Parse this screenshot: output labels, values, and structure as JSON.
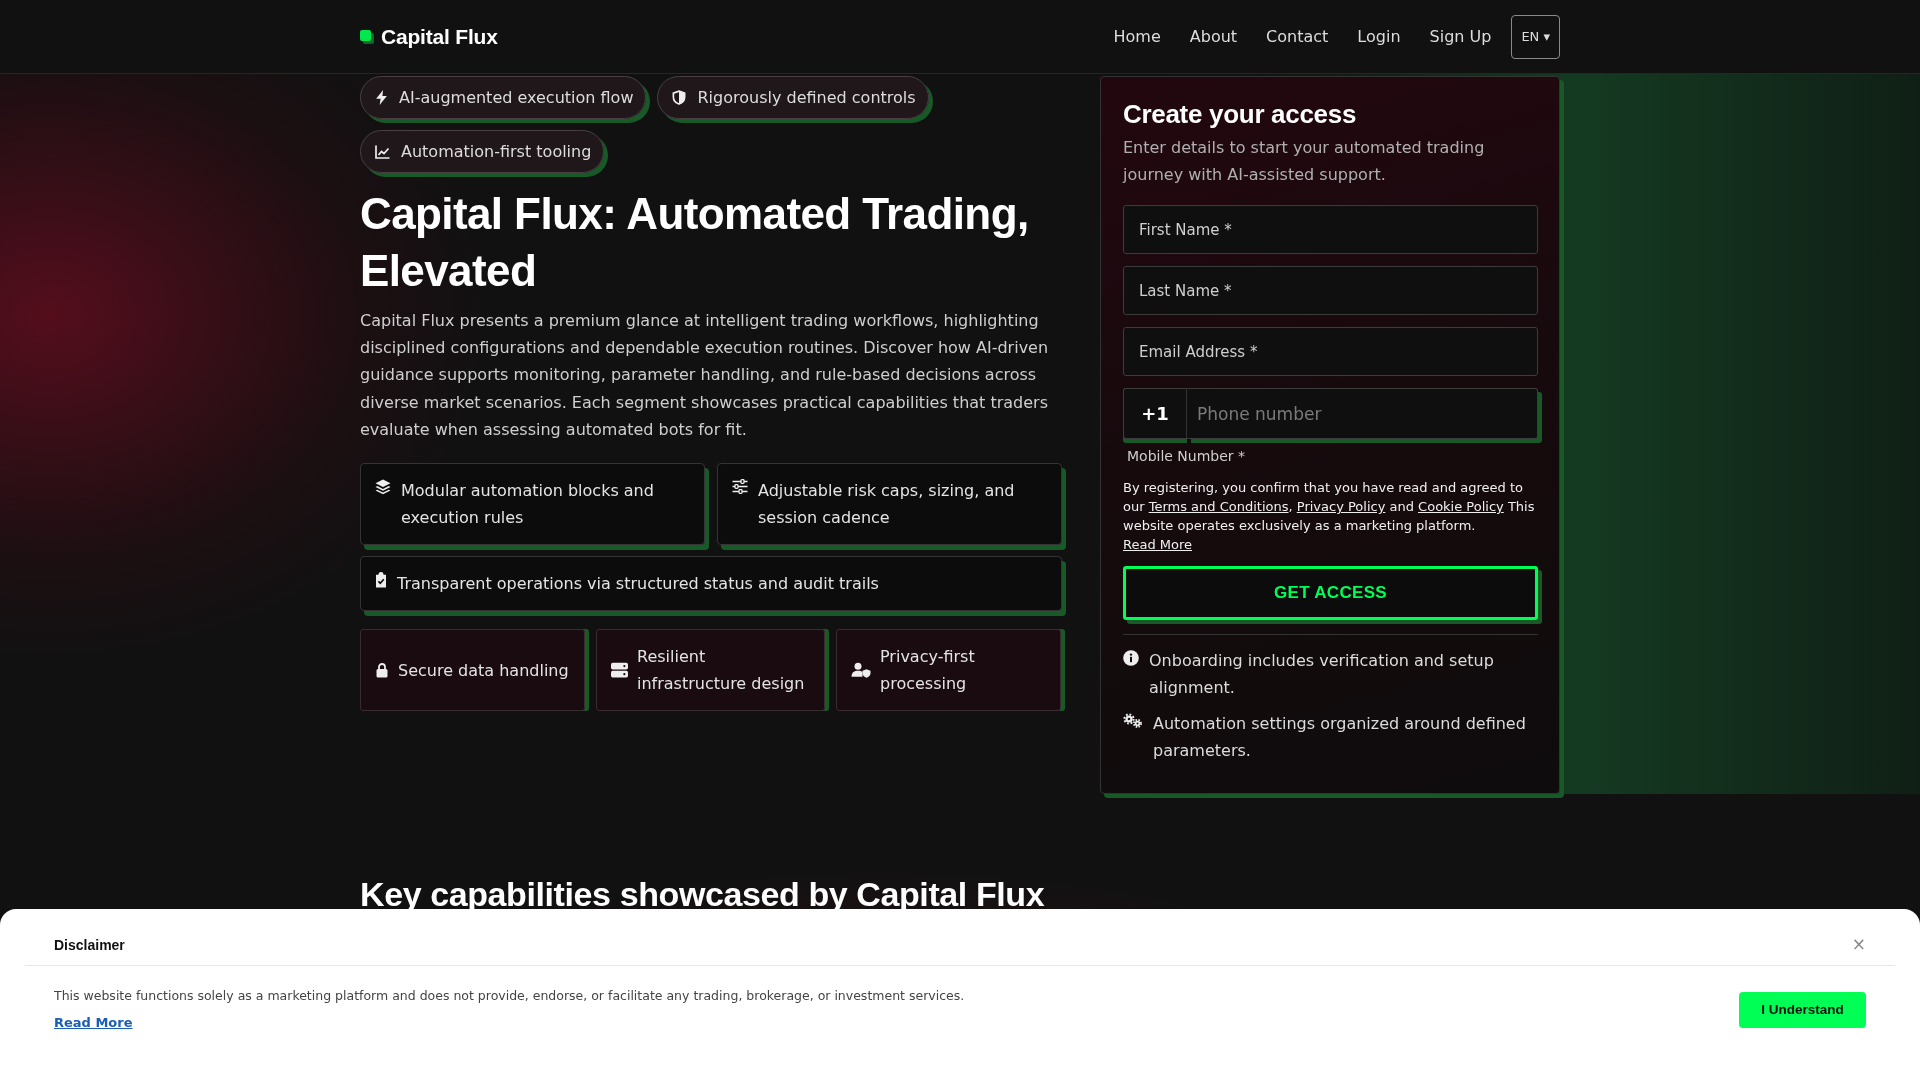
{
  "header": {
    "logo": "Capital Flux",
    "nav": [
      "Home",
      "About",
      "Contact",
      "Login",
      "Sign Up"
    ],
    "language": "EN ▾"
  },
  "hero": {
    "badges": [
      "AI-augmented execution flow",
      "Rigorously defined controls",
      "Automation-first tooling"
    ],
    "title": "Capital Flux: Automated Trading, Elevated",
    "intro": "Capital Flux presents a premium glance at intelligent trading workflows, highlighting disciplined configurations and dependable execution routines. Discover how AI-driven guidance supports monitoring, parameter handling, and rule-based decisions across diverse market scenarios. Each segment showcases practical capabilities that traders evaluate when assessing automated bots for fit.",
    "feature_rows": [
      [
        "Modular automation blocks and execution rules",
        "Adjustable risk caps, sizing, and session cadence"
      ],
      [
        "Transparent operations via structured status and audit trails"
      ]
    ],
    "highlights": [
      "Secure data handling",
      "Resilient infrastructure design",
      "Privacy-first processing"
    ]
  },
  "signup_form": {
    "title": "Create your access",
    "subtitle": "Enter details to start your automated trading journey with AI-assisted support.",
    "fields": [
      {
        "placeholder": "First Name *"
      },
      {
        "placeholder": "Last Name *"
      },
      {
        "placeholder": "Email Address *"
      }
    ],
    "phone": {
      "prefix": "+1",
      "placeholder": "Phone number",
      "label": "Mobile Number *"
    },
    "consent": [
      {
        "kind": "text",
        "text": "By registering, you confirm that you have read and agreed to our "
      },
      {
        "kind": "link",
        "text": "Terms and Conditions"
      },
      {
        "kind": "text",
        "text": ", "
      },
      {
        "kind": "link",
        "text": "Privacy Policy"
      },
      {
        "kind": "text",
        "text": " and "
      },
      {
        "kind": "link",
        "text": "Cookie Policy"
      },
      {
        "kind": "text",
        "text": " This website operates exclusively as a marketing platform. "
      },
      {
        "kind": "link",
        "text": "Read More"
      }
    ],
    "submit": "GET ACCESS",
    "notes": [
      "Onboarding includes verification and setup alignment.",
      "Automation settings organized around defined parameters."
    ]
  },
  "capabilities": {
    "title": "Key capabilities showcased by Capital Flux"
  },
  "disclaimer": {
    "title": "Disclaimer",
    "close": "×",
    "text": "This website functions solely as a marketing platform and does not provide, endorse, or facilitate any trading, brokerage, or investment services.",
    "link": "Read More",
    "button": "I Understand"
  }
}
